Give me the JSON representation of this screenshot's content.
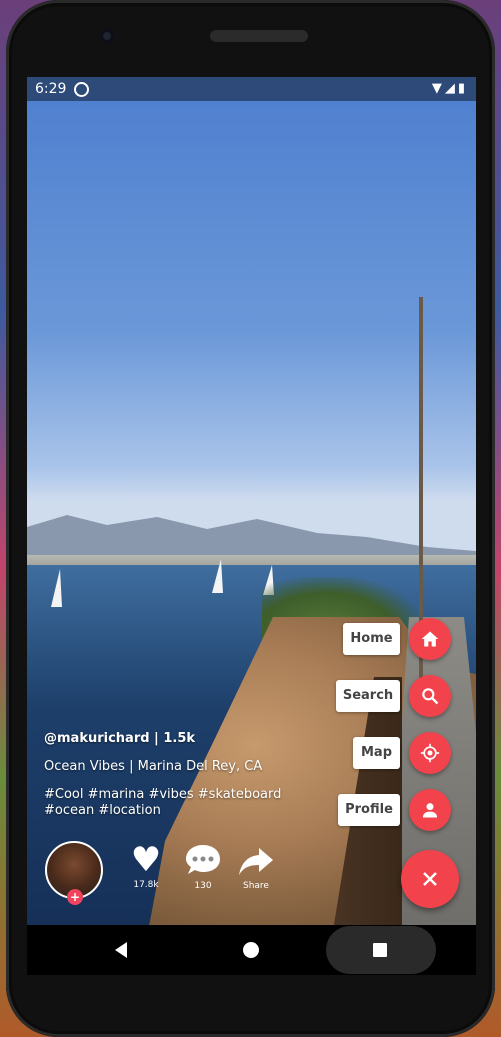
{
  "status_bar": {
    "time": "6:29",
    "icons": [
      "wifi-icon",
      "signal-icon",
      "battery-icon"
    ]
  },
  "post": {
    "user_line": "@makurichard | 1.5k",
    "description": "Ocean Vibes | Marina Del Rey, CA",
    "hashtags": "#Cool #marina #vibes #skateboard #ocean #location"
  },
  "actions": {
    "likes": "17.8k",
    "comments": "130",
    "share_label": "Share"
  },
  "fab_menu": {
    "items": [
      {
        "label": "Home",
        "icon": "home-icon"
      },
      {
        "label": "Search",
        "icon": "search-icon"
      },
      {
        "label": "Map",
        "icon": "crosshair-icon"
      },
      {
        "label": "Profile",
        "icon": "person-icon"
      }
    ],
    "main_icon": "close-icon"
  },
  "colors": {
    "accent": "#f2434d",
    "avatar_badge": "#f0435d"
  }
}
